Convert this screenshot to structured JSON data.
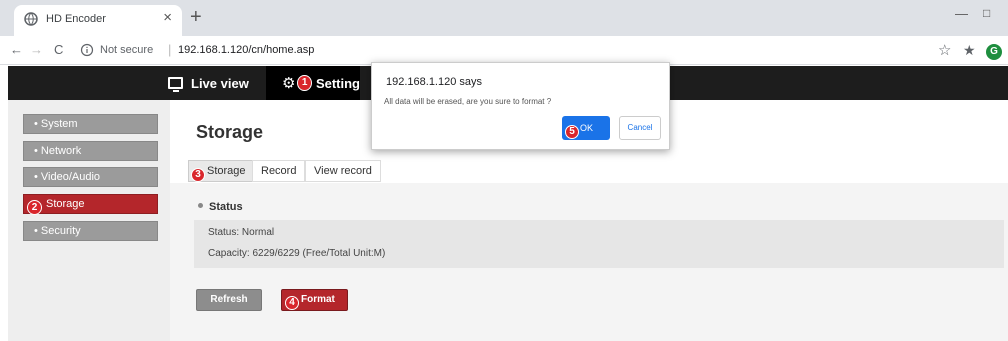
{
  "browser": {
    "tab_title": "HD Encoder",
    "tab_close": "×",
    "new_tab": "+",
    "minimize": "—",
    "maximize": "□",
    "back": "←",
    "forward": "→",
    "reload": "C",
    "security_label": "Not secure",
    "separator": "|",
    "url": "192.168.1.120/cn/home.asp",
    "star": "☆",
    "extensions": "★",
    "profile_initial": "G"
  },
  "header": {
    "live_view": "Live view",
    "setting_marker": "1",
    "setting": "Setting"
  },
  "sidebar": {
    "items": [
      {
        "label": "• System"
      },
      {
        "label": "• Network"
      },
      {
        "label": "• Video/Audio"
      },
      {
        "label": "Storage",
        "marker": "2"
      },
      {
        "label": "• Security"
      }
    ]
  },
  "main": {
    "title": "Storage",
    "tabs": [
      {
        "label": "Storage",
        "marker": "3"
      },
      {
        "label": "Record"
      },
      {
        "label": "View record"
      }
    ],
    "section_title": "Status",
    "status_line": "Status:  Normal",
    "capacity_line": "Capacity:  6229/6229 (Free/Total Unit:M)",
    "refresh_label": "Refresh",
    "format_label": "Format",
    "format_marker": "4"
  },
  "dialog": {
    "title": "192.168.1.120 says",
    "message": "All data will be erased, are you sure to format ?",
    "ok_label": "OK",
    "ok_marker": "5",
    "cancel_label": "Cancel"
  },
  "colors": {
    "accent_red": "#b4262b",
    "marker_red": "#d9262c",
    "dialog_blue": "#1a73e8",
    "appbar": "#1d1d1d"
  }
}
